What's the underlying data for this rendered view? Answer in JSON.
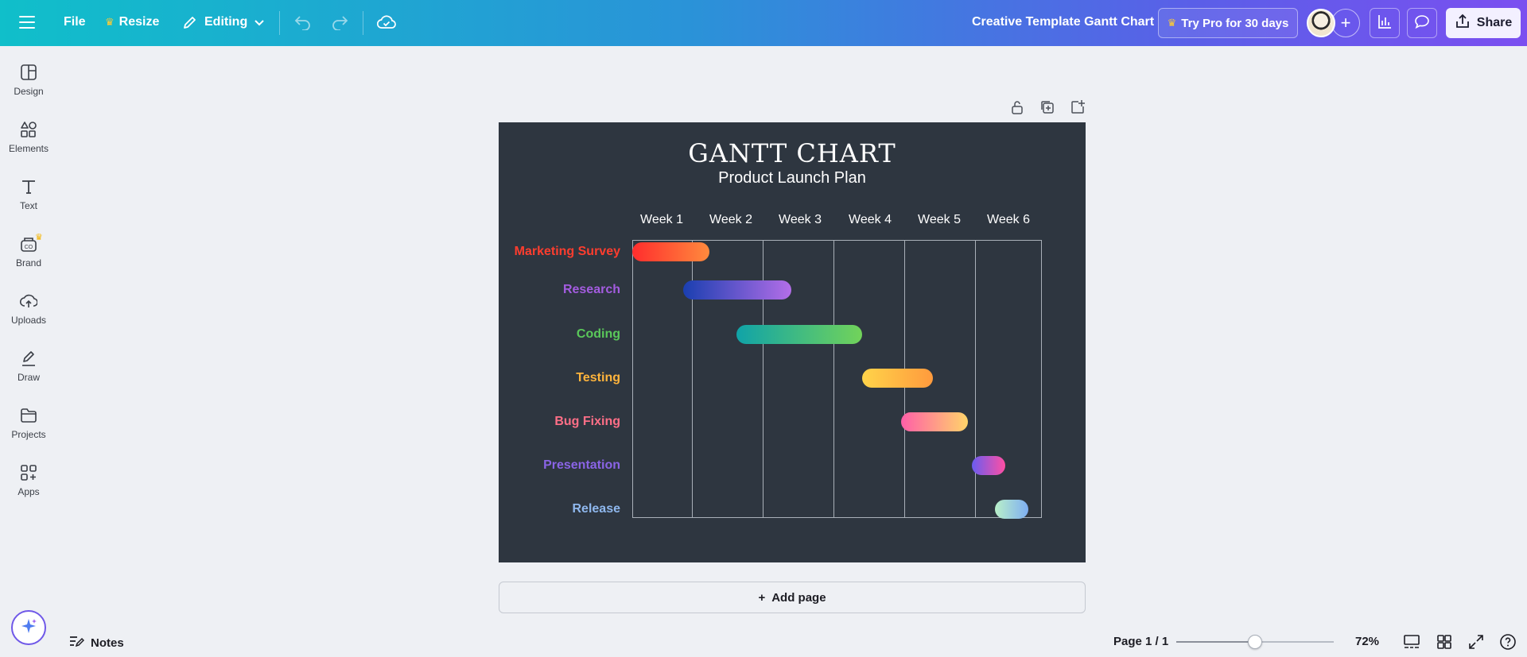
{
  "topbar": {
    "file_label": "File",
    "resize_label": "Resize",
    "editing_label": "Editing",
    "doc_title": "Creative Template Gantt Chart",
    "pro_label": "Try Pro for 30 days",
    "share_label": "Share"
  },
  "sidebar": {
    "items": [
      {
        "label": "Design",
        "icon": "layout-icon"
      },
      {
        "label": "Elements",
        "icon": "shapes-icon"
      },
      {
        "label": "Text",
        "icon": "text-icon"
      },
      {
        "label": "Brand",
        "icon": "brand-icon"
      },
      {
        "label": "Uploads",
        "icon": "cloud-upload-icon"
      },
      {
        "label": "Draw",
        "icon": "pen-icon"
      },
      {
        "label": "Projects",
        "icon": "folder-icon"
      },
      {
        "label": "Apps",
        "icon": "apps-grid-icon"
      }
    ]
  },
  "gantt": {
    "title": "GANTT CHART",
    "subtitle": "Product Launch Plan",
    "weeks": [
      "Week 1",
      "Week 2",
      "Week 3",
      "Week 4",
      "Week 5",
      "Week 6"
    ],
    "tasks": [
      {
        "label": "Marketing Survey",
        "color": "#ff3d2e",
        "start": 0.0,
        "end": 1.25,
        "grad": [
          "#ff2d2d",
          "#ff8a3d"
        ]
      },
      {
        "label": "Research",
        "color": "#a45ce0",
        "start": 0.85,
        "end": 2.4,
        "grad": [
          "#1a3fb0",
          "#b36ee8"
        ]
      },
      {
        "label": "Coding",
        "color": "#5ac85a",
        "start": 1.63,
        "end": 3.4,
        "grad": [
          "#10a3a8",
          "#72d35a"
        ]
      },
      {
        "label": "Testing",
        "color": "#ffb43c",
        "start": 3.4,
        "end": 4.4,
        "grad": [
          "#ffd44a",
          "#ff9a3d"
        ]
      },
      {
        "label": "Bug Fixing",
        "color": "#ff6f87",
        "start": 3.95,
        "end": 4.9,
        "grad": [
          "#ff5fa8",
          "#ffd46a"
        ]
      },
      {
        "label": "Presentation",
        "color": "#8a64e6",
        "start": 4.95,
        "end": 5.45,
        "grad": [
          "#6a5cf0",
          "#ff4fa3"
        ]
      },
      {
        "label": "Release",
        "color": "#8fb8ee",
        "start": 5.3,
        "end": 5.8,
        "grad": [
          "#b9f0c9",
          "#7eaef2"
        ]
      }
    ]
  },
  "canvas": {
    "add_page_label": "Add page"
  },
  "bottombar": {
    "notes_label": "Notes",
    "page_indicator": "Page 1 / 1",
    "zoom_label": "72%",
    "zoom_fraction": 0.5
  }
}
